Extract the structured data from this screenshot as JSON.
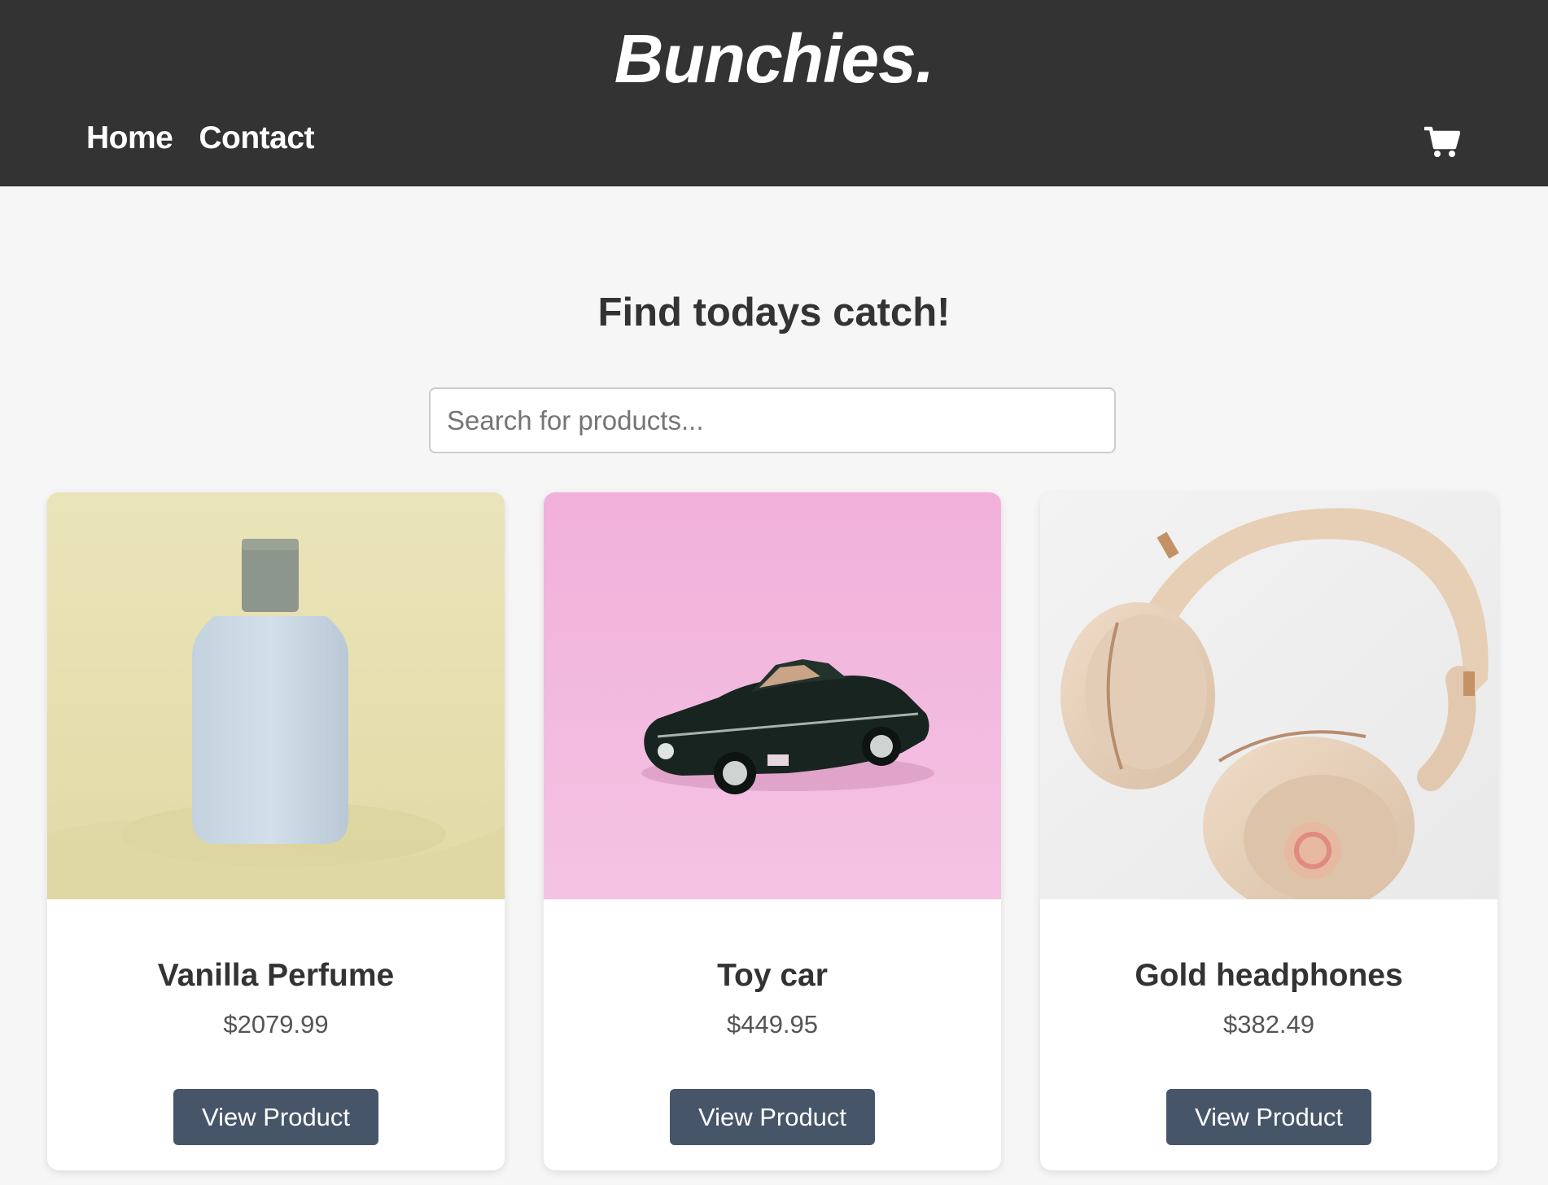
{
  "header": {
    "brand": "Bunchies.",
    "nav": [
      {
        "label": "Home"
      },
      {
        "label": "Contact"
      }
    ],
    "cart_icon": "shopping-cart-icon"
  },
  "hero": {
    "headline": "Find todays catch!",
    "search_placeholder": "Search for products..."
  },
  "products": [
    {
      "name": "Vanilla Perfume",
      "price": "$2079.99",
      "button_label": "View Product",
      "image": "perfume-bottle-photo"
    },
    {
      "name": "Toy car",
      "price": "$449.95",
      "button_label": "View Product",
      "image": "toy-car-photo"
    },
    {
      "name": "Gold headphones",
      "price": "$382.49",
      "button_label": "View Product",
      "image": "headphones-photo"
    }
  ],
  "colors": {
    "header_bg": "#333333",
    "page_bg": "#f6f6f6",
    "button_bg": "#475569"
  }
}
